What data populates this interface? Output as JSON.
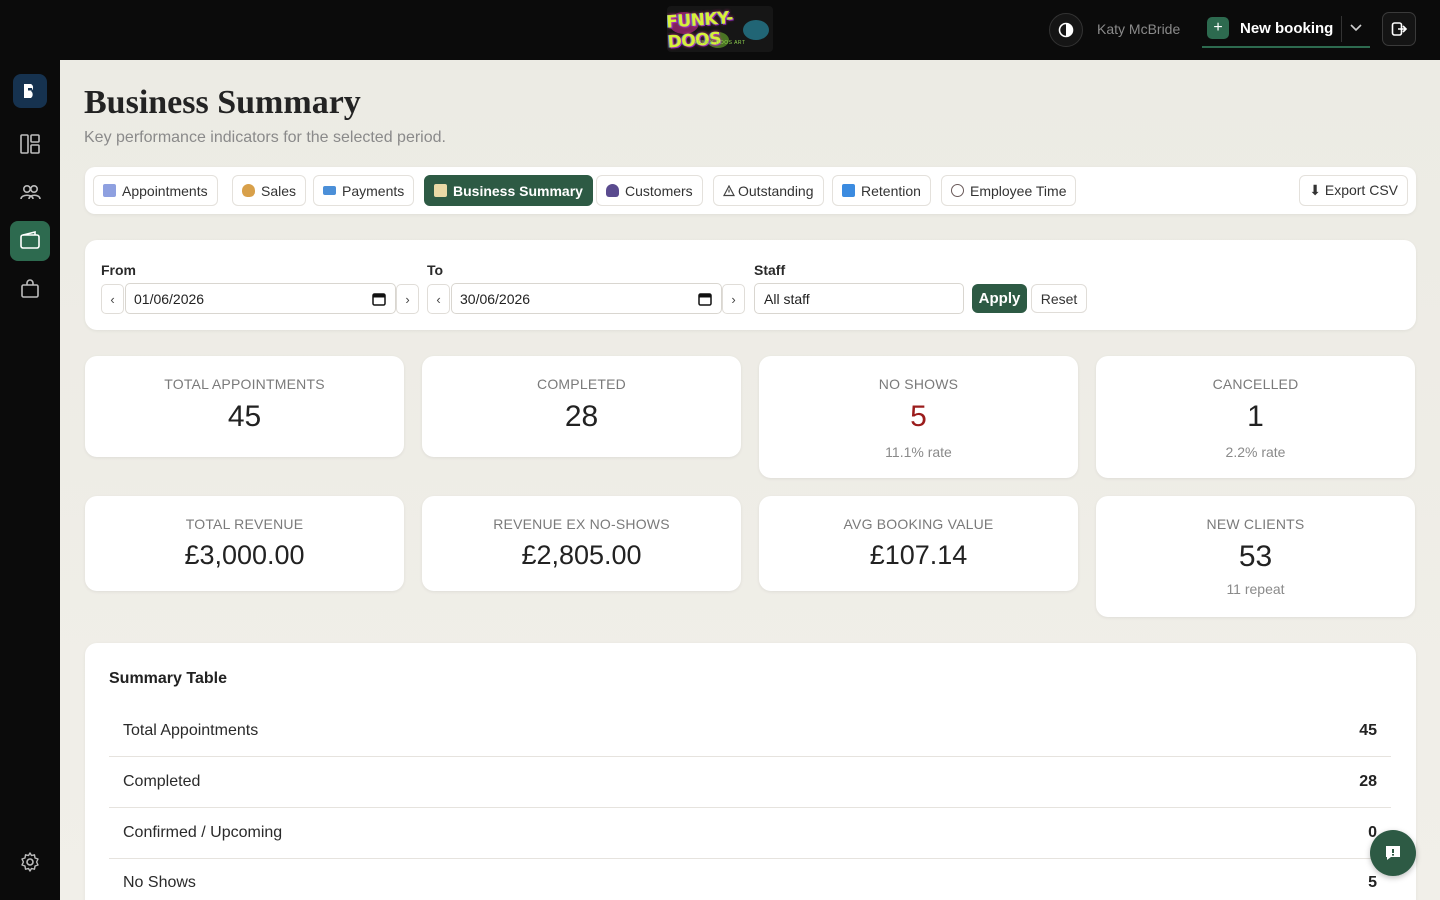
{
  "header": {
    "logo_alt": "FUNKY-DOOS",
    "logo_subtext": "FUNKY DOOS ART",
    "user_name": "Katy McBride",
    "new_booking_label": "New booking"
  },
  "page": {
    "title": "Business Summary",
    "subtitle": "Key performance indicators for the selected period."
  },
  "tabs": [
    {
      "label": "Appointments",
      "icon": "calendar-icon",
      "icon_color": "#7b8fd6"
    },
    {
      "label": "Sales",
      "icon": "money-bag-icon",
      "icon_color": "#d8a04a"
    },
    {
      "label": "Payments",
      "icon": "credit-card-icon",
      "icon_color": "#4b8fd8"
    },
    {
      "label": "Business Summary",
      "icon": "bar-chart-icon",
      "icon_color": "#c9a44a"
    },
    {
      "label": "Customers",
      "icon": "person-icon",
      "icon_color": "#5a4b8f"
    },
    {
      "label": "Outstanding",
      "icon": "warning-icon",
      "icon_color": "#555555"
    },
    {
      "label": "Retention",
      "icon": "refresh-icon",
      "icon_color": "#3b8be0"
    },
    {
      "label": "Employee Time",
      "icon": "clock-icon",
      "icon_color": "#7a6a6a"
    }
  ],
  "export_label": "⬇ Export CSV",
  "filters": {
    "from_label": "From",
    "from_value": "01/06/2026",
    "to_label": "To",
    "to_value": "30/06/2026",
    "staff_label": "Staff",
    "staff_value": "All staff",
    "apply_label": "Apply",
    "reset_label": "Reset"
  },
  "kpis": [
    {
      "label": "TOTAL APPOINTMENTS",
      "value": "45",
      "sub": ""
    },
    {
      "label": "COMPLETED",
      "value": "28",
      "sub": ""
    },
    {
      "label": "NO SHOWS",
      "value": "5",
      "sub": "11.1% rate"
    },
    {
      "label": "CANCELLED",
      "value": "1",
      "sub": "2.2% rate"
    },
    {
      "label": "TOTAL REVENUE",
      "value": "£3,000.00",
      "sub": ""
    },
    {
      "label": "REVENUE EX NO-SHOWS",
      "value": "£2,805.00",
      "sub": ""
    },
    {
      "label": "AVG BOOKING VALUE",
      "value": "£107.14",
      "sub": ""
    },
    {
      "label": "NEW CLIENTS",
      "value": "53",
      "sub": "11 repeat"
    }
  ],
  "summary_table": {
    "title": "Summary Table",
    "rows": [
      {
        "label": "Total Appointments",
        "value": "45"
      },
      {
        "label": "Completed",
        "value": "28"
      },
      {
        "label": "Confirmed / Upcoming",
        "value": "0"
      },
      {
        "label": "No Shows",
        "value": "5"
      }
    ]
  },
  "colors": {
    "accent": "#2d5a44",
    "sidebar_active": "#2d6a4f",
    "danger": "#9b1c1c"
  }
}
